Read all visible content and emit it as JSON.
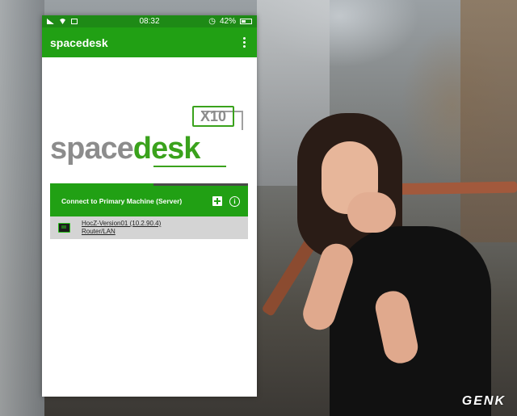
{
  "status_bar": {
    "time": "08:32",
    "battery": "42%"
  },
  "app_bar": {
    "title": "spacedesk"
  },
  "logo": {
    "word_space": "space",
    "word_desk": "desk",
    "badge": "X10"
  },
  "server_panel": {
    "title": "Connect to Primary Machine (Server)",
    "info_glyph": "i",
    "servers": [
      {
        "name": "HocZ-Version01 (10.2.90.4)",
        "connection": "Router/LAN"
      }
    ]
  },
  "watermark": "GENK",
  "colors": {
    "status_bar": "#1e8a16",
    "app_bar": "#21a014",
    "logo_gray": "#8c8c8c",
    "logo_green": "#3aa21c",
    "server_row": "#d4d4d4"
  }
}
